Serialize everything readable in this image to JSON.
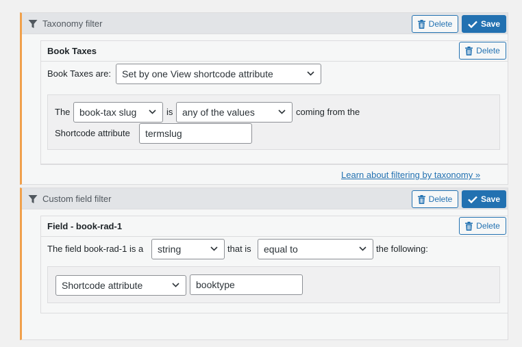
{
  "taxonomy_filter": {
    "title": "Taxonomy filter",
    "delete_label": "Delete",
    "save_label": "Save",
    "block": {
      "title": "Book Taxes",
      "delete_label": "Delete",
      "mode_label": "Book Taxes are:",
      "mode_value": "Set by one View shortcode attribute",
      "rule": {
        "prefix": "The",
        "term_value": "book-tax slug",
        "is_label": "is",
        "compare_value": "any of the values",
        "suffix": "coming from the",
        "attribute_label": "Shortcode attribute",
        "attribute_value": "termslug"
      }
    },
    "learn_link": "Learn about filtering by taxonomy »"
  },
  "custom_field_filter": {
    "title": "Custom field filter",
    "delete_label": "Delete",
    "save_label": "Save",
    "block": {
      "title": "Field - book-rad-1",
      "delete_label": "Delete",
      "field_label": "The field book-rad-1 is a",
      "type_value": "string",
      "that_is_label": "that is",
      "compare_value": "equal to",
      "following_label": "the following:",
      "source_value": "Shortcode attribute",
      "source_input_value": "booktype"
    }
  },
  "colors": {
    "accent": "#2271b1",
    "panel_border_left": "#f0a04b"
  }
}
